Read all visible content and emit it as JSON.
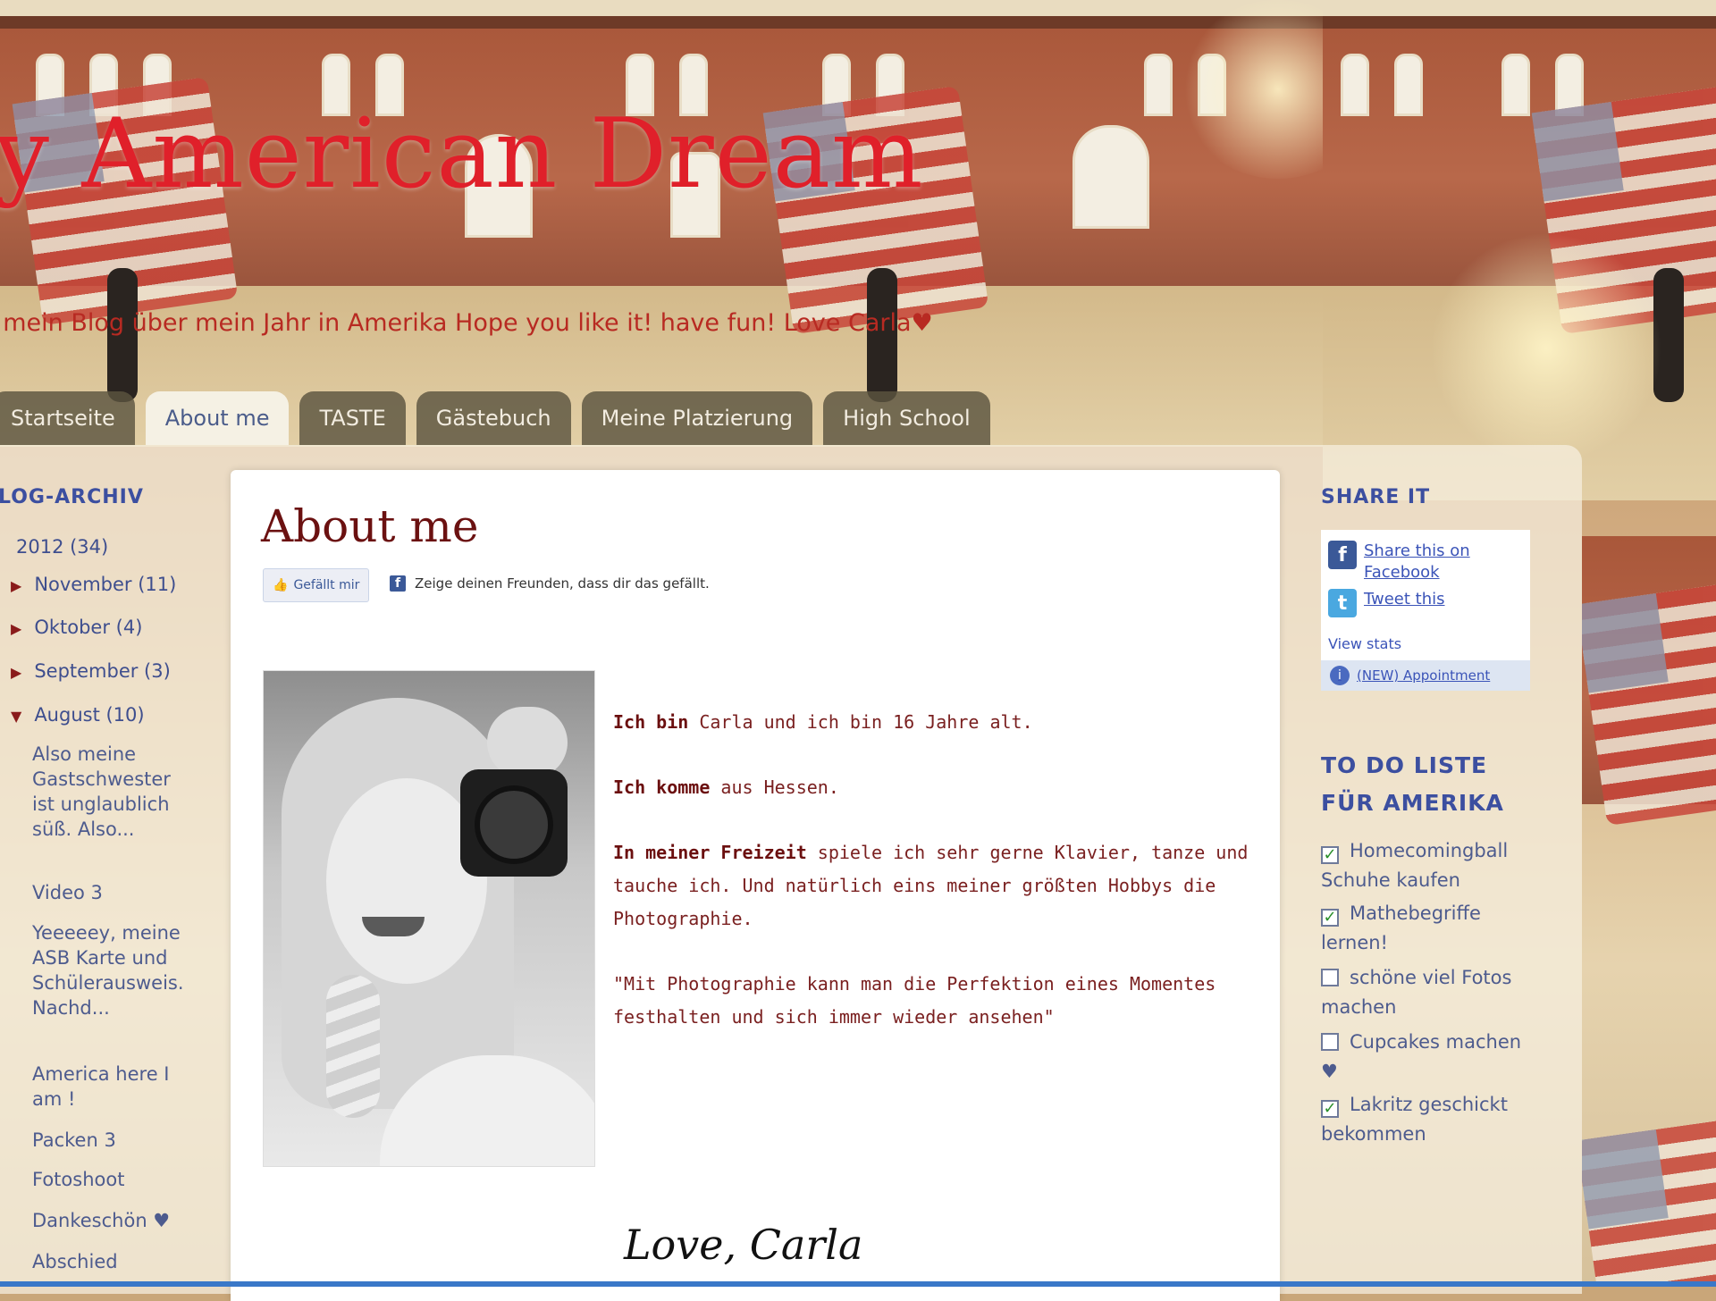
{
  "header": {
    "blog_title": "y American Dream",
    "description": "st mein Blog über mein Jahr in Amerika Hope you like it! have fun! Love Carla♥"
  },
  "tabs": [
    {
      "label": "Startseite",
      "active": false
    },
    {
      "label": "About me",
      "active": true
    },
    {
      "label": "TASTE",
      "active": false
    },
    {
      "label": "Gästebuch",
      "active": false
    },
    {
      "label": "Meine Platzierung",
      "active": false
    },
    {
      "label": "High School",
      "active": false
    }
  ],
  "left_sidebar": {
    "title": "LOG-ARCHIV",
    "year": "2012 (34)",
    "months": [
      {
        "label": "November (11)",
        "caret": "▶"
      },
      {
        "label": "Oktober (4)",
        "caret": "▶"
      },
      {
        "label": "September (3)",
        "caret": "▶"
      },
      {
        "label": "August (10)",
        "caret": "▼"
      }
    ],
    "posts": [
      "Also meine Gastschwester ist unglaublich süß. Also...",
      "Video 3",
      "Yeeeeey, meine ASB Karte und Schülerausweis. Nachd...",
      "America here I am !",
      "Packen 3",
      "Fotoshoot",
      "Dankeschön ♥",
      "Abschied"
    ]
  },
  "post": {
    "title": "About me",
    "like_button": "Gefällt mir",
    "like_prompt": "Zeige deinen Freunden, dass dir das gefällt.",
    "lines": [
      {
        "bold": "Ich bin",
        "rest": " Carla und ich bin 16 Jahre alt."
      },
      {
        "bold": "Ich komme",
        "rest": " aus Hessen."
      },
      {
        "bold": "In meiner Freizeit",
        "rest": " spiele ich sehr gerne Klavier, tanze und tauche ich. Und natürlich eins meiner größten Hobbys die Photographie."
      },
      {
        "bold": "",
        "rest": "\"Mit Photographie kann man die Perfektion eines Momentes festhalten und sich immer wieder ansehen\""
      }
    ],
    "signature": "Love, Carla"
  },
  "right_sidebar": {
    "share_title": "SHARE IT",
    "share_facebook": "Share this on Facebook",
    "share_twitter": "Tweet this",
    "view_stats": "View stats",
    "appointment": "(NEW) Appointment",
    "todo_title": "TO DO LISTE FÜR AMERIKA",
    "todo_items": [
      {
        "label": "Homecomingball Schuhe kaufen",
        "checked": true
      },
      {
        "label": "Mathebegriffe lernen!",
        "checked": true
      },
      {
        "label": "schöne viel Fotos machen",
        "checked": false
      },
      {
        "label": "Cupcakes machen ♥",
        "checked": false
      },
      {
        "label": "Lakritz geschickt bekommen",
        "checked": true
      }
    ]
  },
  "colors": {
    "title_red": "#e0202a",
    "post_text": "#7a2020",
    "sidebar_blue": "#3c4fa0",
    "tab_bg": "#5c5440"
  },
  "icons": [
    "facebook-icon",
    "twitter-icon",
    "info-icon",
    "thumbs-up-icon",
    "caret-right-icon",
    "caret-down-icon",
    "checkbox-icon"
  ]
}
